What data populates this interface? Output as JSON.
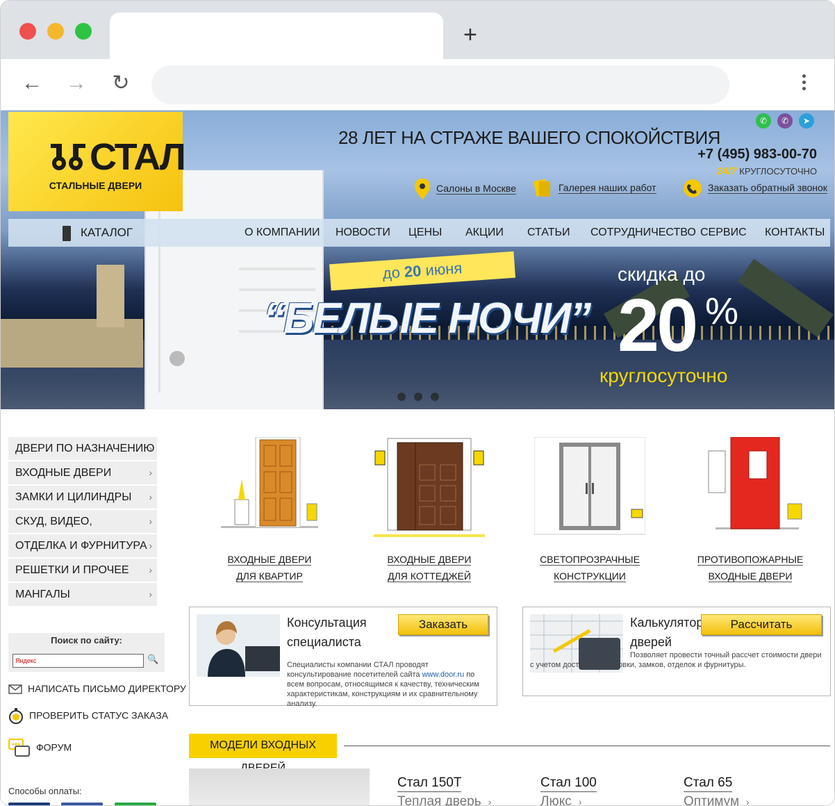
{
  "header": {
    "logo_text": "СТАЛ",
    "logo_sub": "СТАЛЬНЫЕ ДВЕРИ",
    "slogan": "28 ЛЕТ НА СТРАЖЕ ВАШЕГО СПОКОЙСТВИЯ",
    "phone": "+7 (495) 983-00-70",
    "hours_badge": "24/7",
    "hours_text": "КРУГЛОСУТОЧНО",
    "links": {
      "salons": "Салоны в Москве",
      "gallery": "Галерея наших работ",
      "callback": "Заказать обратный звонок"
    },
    "socials": [
      "whatsapp-icon",
      "viber-icon",
      "telegram-icon"
    ]
  },
  "nav": {
    "catalog": "КАТАЛОГ",
    "items": [
      "О КОМПАНИИ",
      "НОВОСТИ",
      "ЦЕНЫ",
      "АКЦИИ",
      "СТАТЬИ",
      "СОТРУДНИЧЕСТВО",
      "СЕРВИС",
      "КОНТАКТЫ"
    ]
  },
  "banner": {
    "badge_prefix": "до",
    "badge_num": "20",
    "badge_suffix": "июня",
    "title": "“БЕЛЫЕ НОЧИ”",
    "discount_prefix": "скидка до",
    "discount_value": "20",
    "discount_pct": "%",
    "discount_suffix": "круглосуточно"
  },
  "sidebar": {
    "items": [
      {
        "label": "ДВЕРИ ПО НАЗНАЧЕНИЮ"
      },
      {
        "label": "ВХОДНЫЕ ДВЕРИ"
      },
      {
        "label": "ЗАМКИ И ЦИЛИНДРЫ"
      },
      {
        "label": "СКУД, ВИДЕО, ДОМОФОНЫ"
      },
      {
        "label": "ОТДЕЛКА И ФУРНИТУРА"
      },
      {
        "label": "РЕШЕТКИ И ПРОЧЕЕ"
      },
      {
        "label": "МАНГАЛЫ"
      }
    ],
    "search_label": "Поиск по сайту:",
    "search_placeholder": "Яндекс",
    "write_director": "НАПИСАТЬ ПИСЬМО ДИРЕКТОРУ",
    "order_status": "ПРОВЕРИТЬ СТАТУС ЗАКАЗА",
    "forum": "ФОРУМ",
    "payments": "Способы оплаты:"
  },
  "categories": [
    {
      "line1": "ВХОДНЫЕ ДВЕРИ",
      "line2": "ДЛЯ КВАРТИР",
      "door_color": "#d98a2a"
    },
    {
      "line1": "ВХОДНЫЕ ДВЕРИ",
      "line2": "ДЛЯ КОТТЕДЖЕЙ",
      "door_color": "#6b3a20"
    },
    {
      "line1": "СВЕТОПРОЗРАЧНЫЕ",
      "line2": "КОНСТРУКЦИИ",
      "door_color": "#8a8a8a"
    },
    {
      "line1": "ПРОТИВОПОЖАРНЫЕ",
      "line2": "ВХОДНЫЕ ДВЕРИ",
      "door_color": "#e42820"
    }
  ],
  "consult": {
    "title1": "Консультация",
    "title2": "специалиста",
    "button": "Заказать",
    "text_before": "Специалисты компании СТАЛ проводят консультирование посетителей сайта",
    "link": "www.door.ru",
    "text_after": "по всем вопросам, относящимся к качеству, техническим характеристикам, конструкциям и их сравнительному анализу."
  },
  "calculator": {
    "title1": "Калькулятор",
    "title2": "дверей",
    "button": "Рассчитать",
    "text": "Позволяет провести точный рассчет стоимости двери с учетом доставки, установки, замков, отделок и фурнитуры."
  },
  "models": {
    "header": "МОДЕЛИ ВХОДНЫХ ДВЕРЕЙ",
    "items": [
      {
        "name": "Стал 150T",
        "sub": "Теплая дверь"
      },
      {
        "name": "Стал 100",
        "sub": "Люкс"
      },
      {
        "name": "Стал 65",
        "sub": "Оптимум"
      }
    ]
  }
}
